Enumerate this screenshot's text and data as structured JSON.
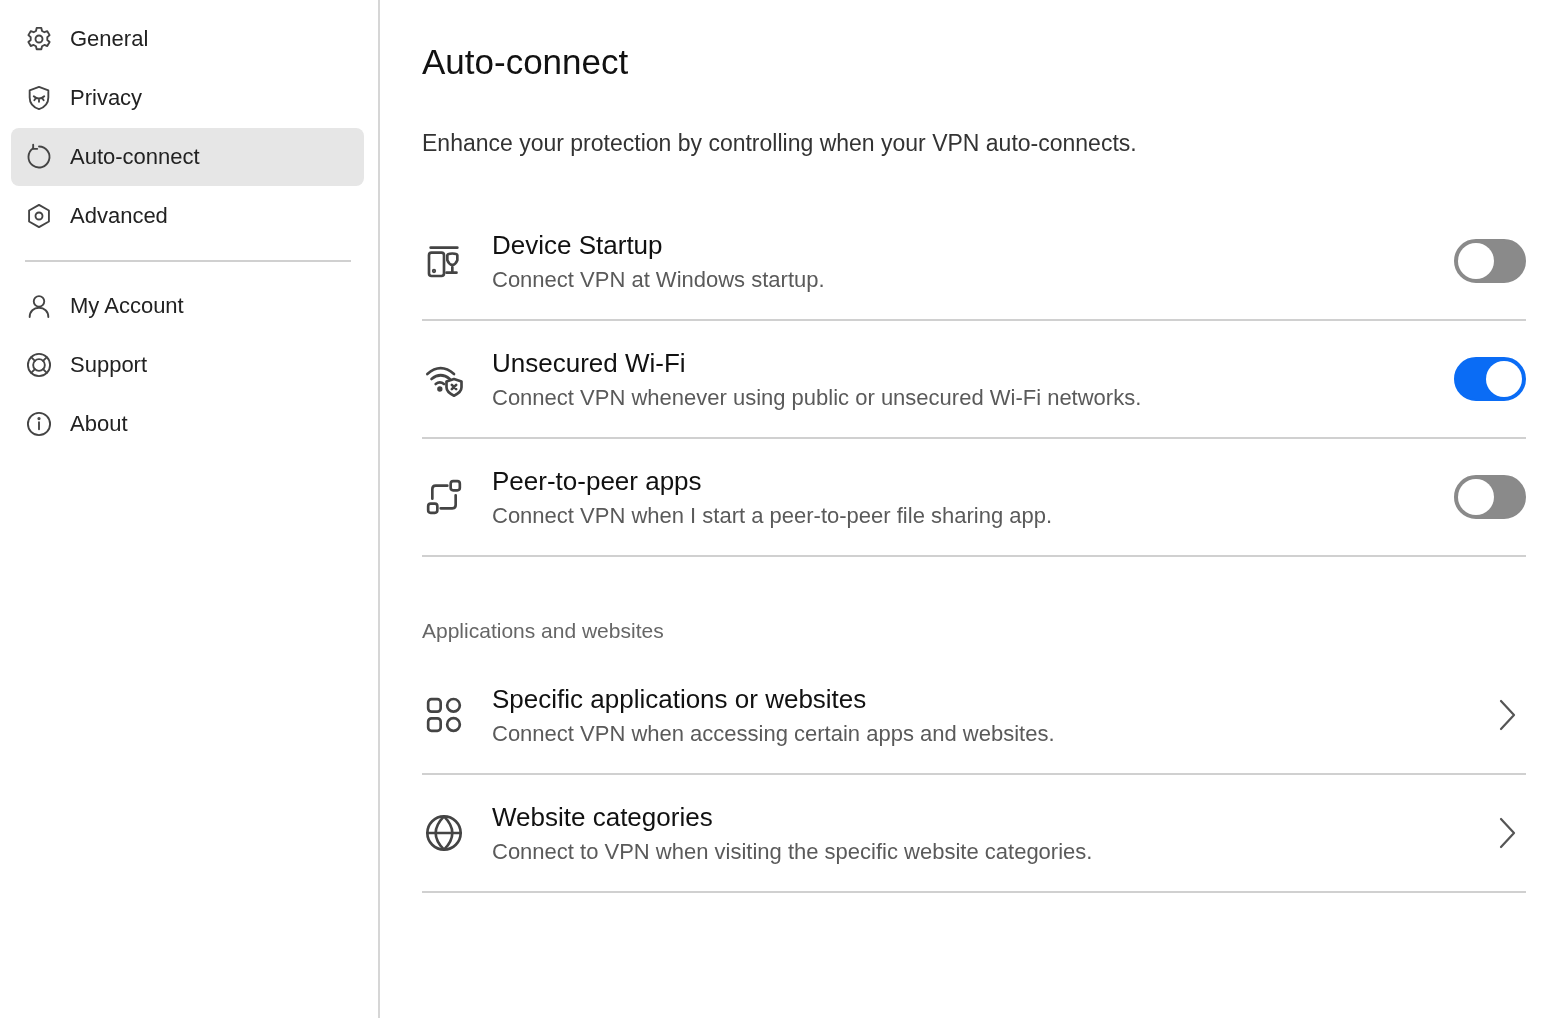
{
  "sidebar": {
    "items": [
      {
        "label": "General",
        "selected": false
      },
      {
        "label": "Privacy",
        "selected": false
      },
      {
        "label": "Auto-connect",
        "selected": true
      },
      {
        "label": "Advanced",
        "selected": false
      }
    ],
    "account_items": [
      {
        "label": "My Account",
        "selected": false
      },
      {
        "label": "Support",
        "selected": false
      },
      {
        "label": "About",
        "selected": false
      }
    ]
  },
  "page": {
    "title": "Auto-connect",
    "subtitle": "Enhance your protection by controlling when your VPN auto-connects.",
    "toggles": [
      {
        "title": "Device Startup",
        "description": "Connect VPN at Windows startup.",
        "on": false
      },
      {
        "title": "Unsecured Wi-Fi",
        "description": "Connect VPN whenever using public or unsecured Wi-Fi networks.",
        "on": true
      },
      {
        "title": "Peer-to-peer apps",
        "description": "Connect VPN when I start a peer-to-peer file sharing app.",
        "on": false
      }
    ],
    "section_label": "Applications and websites",
    "links": [
      {
        "title": "Specific applications or websites",
        "description": "Connect VPN when accessing certain apps and websites."
      },
      {
        "title": "Website categories",
        "description": "Connect to VPN when visiting the specific website categories."
      }
    ]
  }
}
